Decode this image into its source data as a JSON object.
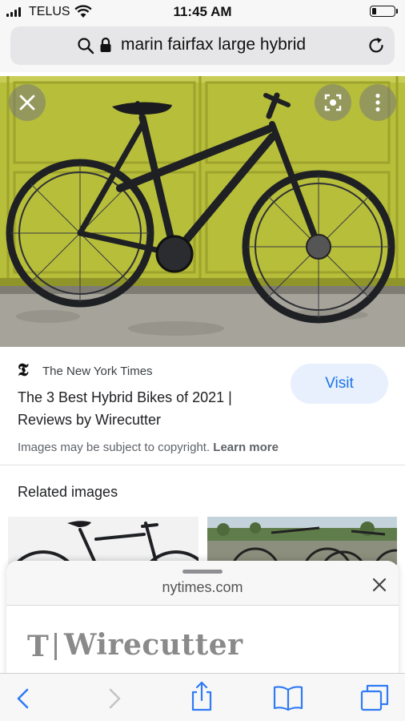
{
  "status_bar": {
    "carrier": "TELUS",
    "time": "11:45 AM",
    "battery_level": 0.2
  },
  "address_bar": {
    "url_text": "marin fairfax large hybrid",
    "icons": [
      "search-icon",
      "lock-icon",
      "reload-icon"
    ]
  },
  "image_viewer": {
    "close_icon": "close-icon",
    "lens_icon": "lens-icon",
    "more_icon": "more-vertical-icon"
  },
  "result": {
    "source_name": "The New York Times",
    "title": "The 3 Best Hybrid Bikes of 2021 | Reviews by Wirecutter",
    "visit_label": "Visit",
    "copyright_text": "Images may be subject to copyright.",
    "learn_more": "Learn more"
  },
  "related": {
    "heading": "Related images"
  },
  "sheet": {
    "domain": "nytimes.com",
    "brand_text": "Wirecutter",
    "brand_glyph": "T"
  },
  "toolbar": {
    "icons": [
      "back-icon",
      "forward-icon",
      "share-icon",
      "bookmarks-icon",
      "tabs-icon"
    ]
  },
  "colors": {
    "accent": "#1a73e8",
    "visit_bg": "#e8f0fe",
    "garage_yellow": "#b9c23a"
  }
}
